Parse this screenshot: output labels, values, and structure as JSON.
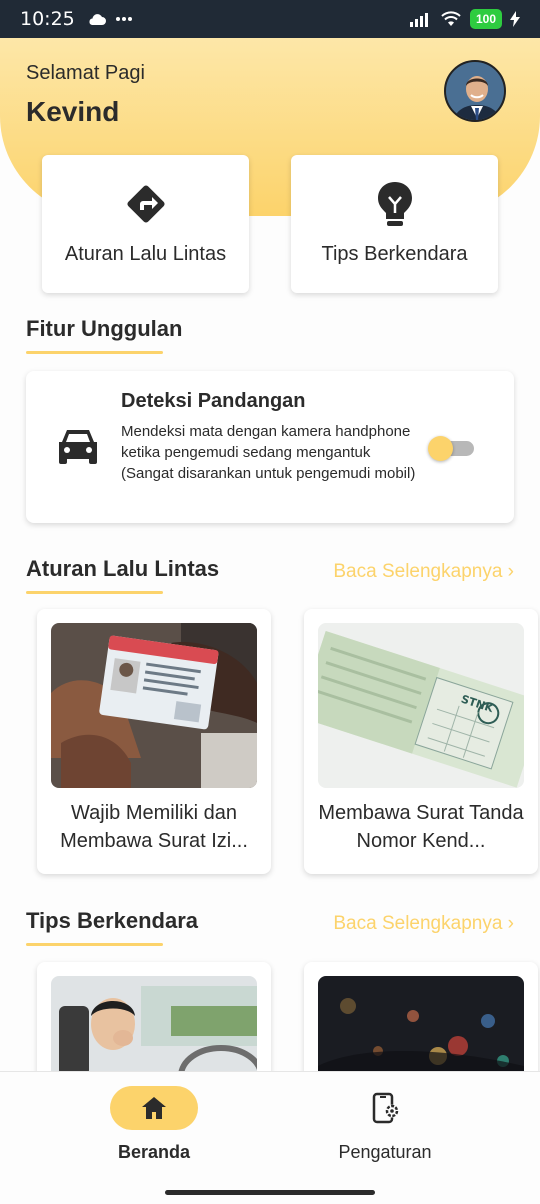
{
  "status_bar": {
    "time": "10:25",
    "battery": "100"
  },
  "header": {
    "greeting": "Selamat Pagi",
    "username": "Kevind"
  },
  "quick_actions": [
    {
      "label": "Aturan Lalu Lintas",
      "icon": "directions-icon"
    },
    {
      "label": "Tips Berkendara",
      "icon": "lightbulb-icon"
    }
  ],
  "featured": {
    "title": "Fitur Unggulan",
    "card": {
      "title": "Deteksi Pandangan",
      "description": "Mendeksi mata dengan kamera handphone ketika pengemudi sedang mengantuk (Sangat disarankan untuk pengemudi mobil)",
      "toggle_on": false
    }
  },
  "traffic_rules": {
    "title": "Aturan Lalu Lintas",
    "more": "Baca Selengkapnya",
    "articles": [
      {
        "title": "Wajib Memiliki dan Membawa Surat Izi..."
      },
      {
        "title": "Membawa Surat Tanda Nomor Kend..."
      }
    ]
  },
  "driving_tips": {
    "title": "Tips Berkendara",
    "more": "Baca Selengkapnya"
  },
  "bottom_nav": [
    {
      "label": "Beranda",
      "icon": "home-icon",
      "active": true
    },
    {
      "label": "Pengaturan",
      "icon": "settings-phone-icon",
      "active": false
    }
  ],
  "colors": {
    "accent": "#fcd36b",
    "text": "#2b2b2b",
    "status_bar": "#202a36"
  }
}
